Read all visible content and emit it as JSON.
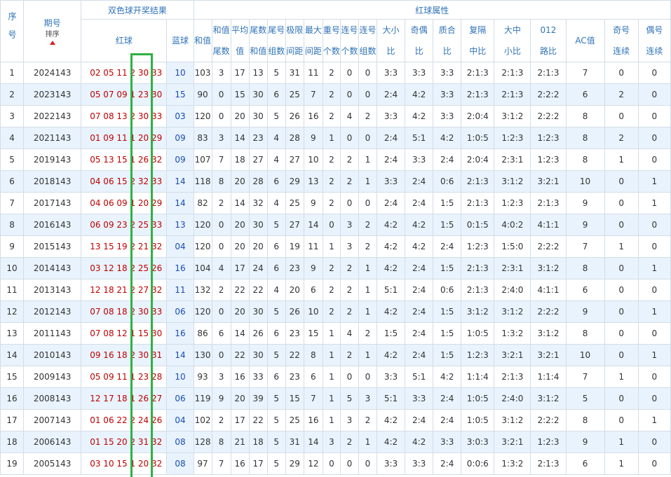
{
  "header": {
    "seq": "序号",
    "period": "期号",
    "sort": "排序",
    "result_group": "双色球开奖结果",
    "red": "红球",
    "blue": "蓝球",
    "attr_group": "红球属性",
    "sum": "和值",
    "sum_tail": [
      "和值",
      "尾数"
    ],
    "avg": [
      "平均",
      "值"
    ],
    "tail_sum": [
      "尾数",
      "和值"
    ],
    "tail_group": [
      "尾号",
      "组数"
    ],
    "range": [
      "极限",
      "间距"
    ],
    "max_gap": [
      "最大",
      "间距"
    ],
    "repeat": [
      "重号",
      "个数"
    ],
    "consec": [
      "连号",
      "个数"
    ],
    "consec_group": [
      "连号",
      "组数"
    ],
    "big_small": [
      "大小",
      "比"
    ],
    "odd_even": [
      "奇偶",
      "比"
    ],
    "prime": [
      "质合",
      "比"
    ],
    "gap": [
      "复隔",
      "中比"
    ],
    "bms": [
      "大中",
      "小比"
    ],
    "path": [
      "012",
      "路比"
    ],
    "ac": "AC值",
    "odd_run": [
      "奇号",
      "连续"
    ],
    "even_run": [
      "偶号",
      "连续"
    ]
  },
  "rows": [
    {
      "seq": "1",
      "period": "2024143",
      "reds": "02 05 11 2 30 33",
      "blue": "10",
      "sum": "103",
      "st": "3",
      "avg": "17",
      "ts": "13",
      "tg": "5",
      "range": "31",
      "mg": "11",
      "rep": "2",
      "con": "0",
      "cg": "0",
      "bs": "3:3",
      "oe": "3:3",
      "pr": "3:3",
      "gap": "2:1:3",
      "bms": "2:1:3",
      "path": "2:1:3",
      "ac": "7",
      "or": "0",
      "er": "0"
    },
    {
      "seq": "2",
      "period": "2023143",
      "reds": "05 07 09 1 23 30",
      "blue": "15",
      "sum": "90",
      "st": "0",
      "avg": "15",
      "ts": "30",
      "tg": "6",
      "range": "25",
      "mg": "7",
      "rep": "2",
      "con": "0",
      "cg": "0",
      "bs": "2:4",
      "oe": "4:2",
      "pr": "3:3",
      "gap": "2:1:3",
      "bms": "2:1:3",
      "path": "2:2:2",
      "ac": "6",
      "or": "2",
      "er": "0"
    },
    {
      "seq": "3",
      "period": "2022143",
      "reds": "07 08 13 2 30 33",
      "blue": "03",
      "sum": "120",
      "st": "0",
      "avg": "20",
      "ts": "30",
      "tg": "5",
      "range": "26",
      "mg": "16",
      "rep": "2",
      "con": "4",
      "cg": "2",
      "bs": "3:3",
      "oe": "4:2",
      "pr": "3:3",
      "gap": "2:0:4",
      "bms": "3:1:2",
      "path": "2:2:2",
      "ac": "8",
      "or": "0",
      "er": "0"
    },
    {
      "seq": "4",
      "period": "2021143",
      "reds": "01 09 11 1 20 29",
      "blue": "09",
      "sum": "83",
      "st": "3",
      "avg": "14",
      "ts": "23",
      "tg": "4",
      "range": "28",
      "mg": "9",
      "rep": "1",
      "con": "0",
      "cg": "0",
      "bs": "2:4",
      "oe": "5:1",
      "pr": "4:2",
      "gap": "1:0:5",
      "bms": "1:2:3",
      "path": "1:2:3",
      "ac": "8",
      "or": "2",
      "er": "0"
    },
    {
      "seq": "5",
      "period": "2019143",
      "reds": "05 13 15 1 26 32",
      "blue": "09",
      "sum": "107",
      "st": "7",
      "avg": "18",
      "ts": "27",
      "tg": "4",
      "range": "27",
      "mg": "10",
      "rep": "2",
      "con": "2",
      "cg": "1",
      "bs": "2:4",
      "oe": "3:3",
      "pr": "2:4",
      "gap": "2:0:4",
      "bms": "2:3:1",
      "path": "1:2:3",
      "ac": "8",
      "or": "1",
      "er": "0"
    },
    {
      "seq": "6",
      "period": "2018143",
      "reds": "04 06 15 2 32 33",
      "blue": "14",
      "sum": "118",
      "st": "8",
      "avg": "20",
      "ts": "28",
      "tg": "6",
      "range": "29",
      "mg": "13",
      "rep": "2",
      "con": "2",
      "cg": "1",
      "bs": "3:3",
      "oe": "2:4",
      "pr": "0:6",
      "gap": "2:1:3",
      "bms": "3:1:2",
      "path": "3:2:1",
      "ac": "10",
      "or": "0",
      "er": "1"
    },
    {
      "seq": "7",
      "period": "2017143",
      "reds": "04 06 09 1 20 29",
      "blue": "14",
      "sum": "82",
      "st": "2",
      "avg": "14",
      "ts": "32",
      "tg": "4",
      "range": "25",
      "mg": "9",
      "rep": "2",
      "con": "0",
      "cg": "0",
      "bs": "2:4",
      "oe": "2:4",
      "pr": "1:5",
      "gap": "2:1:3",
      "bms": "1:2:3",
      "path": "2:1:3",
      "ac": "9",
      "or": "0",
      "er": "1"
    },
    {
      "seq": "8",
      "period": "2016143",
      "reds": "06 09 23 2 25 33",
      "blue": "13",
      "sum": "120",
      "st": "0",
      "avg": "20",
      "ts": "30",
      "tg": "5",
      "range": "27",
      "mg": "14",
      "rep": "0",
      "con": "3",
      "cg": "2",
      "bs": "4:2",
      "oe": "4:2",
      "pr": "1:5",
      "gap": "0:1:5",
      "bms": "4:0:2",
      "path": "4:1:1",
      "ac": "9",
      "or": "0",
      "er": "0"
    },
    {
      "seq": "9",
      "period": "2015143",
      "reds": "13 15 19 2 21 32",
      "blue": "04",
      "sum": "120",
      "st": "0",
      "avg": "20",
      "ts": "20",
      "tg": "6",
      "range": "19",
      "mg": "11",
      "rep": "1",
      "con": "3",
      "cg": "2",
      "bs": "4:2",
      "oe": "4:2",
      "pr": "2:4",
      "gap": "1:2:3",
      "bms": "1:5:0",
      "path": "2:2:2",
      "ac": "7",
      "or": "1",
      "er": "0"
    },
    {
      "seq": "10",
      "period": "2014143",
      "reds": "03 12 18 2 25 26",
      "blue": "16",
      "sum": "104",
      "st": "4",
      "avg": "17",
      "ts": "24",
      "tg": "6",
      "range": "23",
      "mg": "9",
      "rep": "2",
      "con": "2",
      "cg": "1",
      "bs": "4:2",
      "oe": "2:4",
      "pr": "1:5",
      "gap": "2:1:3",
      "bms": "2:3:1",
      "path": "3:1:2",
      "ac": "8",
      "or": "0",
      "er": "1"
    },
    {
      "seq": "11",
      "period": "2013143",
      "reds": "12 18 21 2 27 32",
      "blue": "11",
      "sum": "132",
      "st": "2",
      "avg": "22",
      "ts": "22",
      "tg": "4",
      "range": "20",
      "mg": "6",
      "rep": "2",
      "con": "2",
      "cg": "1",
      "bs": "5:1",
      "oe": "2:4",
      "pr": "0:6",
      "gap": "2:1:3",
      "bms": "2:4:0",
      "path": "4:1:1",
      "ac": "6",
      "or": "0",
      "er": "0"
    },
    {
      "seq": "12",
      "period": "2012143",
      "reds": "07 08 18 2 30 33",
      "blue": "06",
      "sum": "120",
      "st": "0",
      "avg": "20",
      "ts": "30",
      "tg": "5",
      "range": "26",
      "mg": "10",
      "rep": "2",
      "con": "2",
      "cg": "1",
      "bs": "4:2",
      "oe": "2:4",
      "pr": "1:5",
      "gap": "3:1:2",
      "bms": "3:1:2",
      "path": "2:2:2",
      "ac": "9",
      "or": "0",
      "er": "1"
    },
    {
      "seq": "13",
      "period": "2011143",
      "reds": "07 08 12 1 15 30",
      "blue": "16",
      "sum": "86",
      "st": "6",
      "avg": "14",
      "ts": "26",
      "tg": "6",
      "range": "23",
      "mg": "15",
      "rep": "1",
      "con": "4",
      "cg": "2",
      "bs": "1:5",
      "oe": "2:4",
      "pr": "1:5",
      "gap": "1:0:5",
      "bms": "1:3:2",
      "path": "3:1:2",
      "ac": "8",
      "or": "0",
      "er": "0"
    },
    {
      "seq": "14",
      "period": "2010143",
      "reds": "09 16 18 2 30 31",
      "blue": "14",
      "sum": "130",
      "st": "0",
      "avg": "22",
      "ts": "30",
      "tg": "5",
      "range": "22",
      "mg": "8",
      "rep": "1",
      "con": "2",
      "cg": "1",
      "bs": "4:2",
      "oe": "2:4",
      "pr": "1:5",
      "gap": "1:2:3",
      "bms": "3:2:1",
      "path": "3:2:1",
      "ac": "10",
      "or": "0",
      "er": "1"
    },
    {
      "seq": "15",
      "period": "2009143",
      "reds": "05 09 11 1 23 28",
      "blue": "10",
      "sum": "93",
      "st": "3",
      "avg": "16",
      "ts": "33",
      "tg": "6",
      "range": "23",
      "mg": "6",
      "rep": "1",
      "con": "0",
      "cg": "0",
      "bs": "3:3",
      "oe": "5:1",
      "pr": "4:2",
      "gap": "1:1:4",
      "bms": "2:1:3",
      "path": "1:1:4",
      "ac": "7",
      "or": "1",
      "er": "0"
    },
    {
      "seq": "16",
      "period": "2008143",
      "reds": "12 17 18 1 26 27",
      "blue": "06",
      "sum": "119",
      "st": "9",
      "avg": "20",
      "ts": "39",
      "tg": "5",
      "range": "15",
      "mg": "7",
      "rep": "1",
      "con": "5",
      "cg": "3",
      "bs": "5:1",
      "oe": "3:3",
      "pr": "2:4",
      "gap": "1:0:5",
      "bms": "2:4:0",
      "path": "3:1:2",
      "ac": "5",
      "or": "0",
      "er": "0"
    },
    {
      "seq": "17",
      "period": "2007143",
      "reds": "01 06 22 2 24 26",
      "blue": "04",
      "sum": "102",
      "st": "2",
      "avg": "17",
      "ts": "22",
      "tg": "5",
      "range": "25",
      "mg": "16",
      "rep": "1",
      "con": "3",
      "cg": "2",
      "bs": "4:2",
      "oe": "2:4",
      "pr": "2:4",
      "gap": "1:0:5",
      "bms": "3:1:2",
      "path": "2:2:2",
      "ac": "8",
      "or": "0",
      "er": "1"
    },
    {
      "seq": "18",
      "period": "2006143",
      "reds": "01 15 20 2 31 32",
      "blue": "08",
      "sum": "128",
      "st": "8",
      "avg": "21",
      "ts": "18",
      "tg": "5",
      "range": "31",
      "mg": "14",
      "rep": "3",
      "con": "2",
      "cg": "1",
      "bs": "4:2",
      "oe": "4:2",
      "pr": "3:3",
      "gap": "3:0:3",
      "bms": "3:2:1",
      "path": "1:2:3",
      "ac": "9",
      "or": "1",
      "er": "0"
    },
    {
      "seq": "19",
      "period": "2005143",
      "reds": "03 10 15 1 20 32",
      "blue": "08",
      "sum": "97",
      "st": "7",
      "avg": "16",
      "ts": "17",
      "tg": "5",
      "range": "29",
      "mg": "12",
      "rep": "0",
      "con": "0",
      "cg": "0",
      "bs": "3:3",
      "oe": "3:3",
      "pr": "2:4",
      "gap": "0:0:6",
      "bms": "1:3:2",
      "path": "2:1:3",
      "ac": "6",
      "or": "1",
      "er": "0"
    }
  ]
}
